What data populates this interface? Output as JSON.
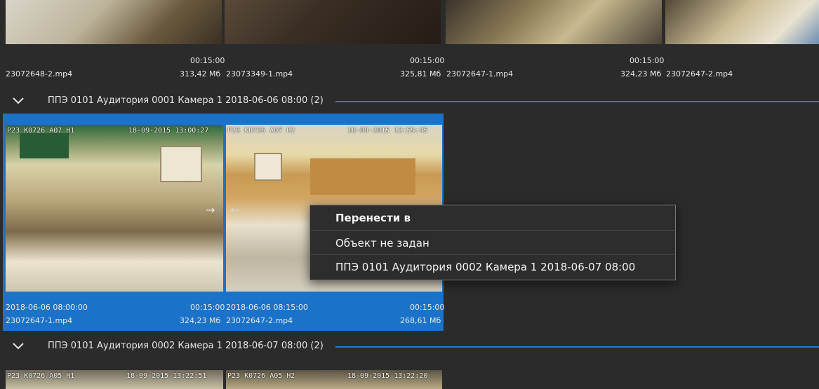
{
  "colors": {
    "background": "#2b2b2b",
    "selection": "#1a73c9",
    "accent_line": "#1f7bd1",
    "menu_bg": "#2d2d2d"
  },
  "top_row": {
    "items": [
      {
        "duration": "00:15:00",
        "filename": "23072648-2.mp4",
        "size": ""
      },
      {
        "duration": "00:15:00",
        "filename": "23073349-1.mp4",
        "size": "313,42 Мб"
      },
      {
        "duration": "00:15:00",
        "filename": "23072647-1.mp4",
        "size": "325,81 Мб"
      },
      {
        "duration": "",
        "filename": "23072647-2.mp4",
        "size": "324,23 Мб"
      }
    ]
  },
  "groups": [
    {
      "title": "ППЭ 0101 Аудитория 0001 Камера 1 2018-06-06 08:00 (2)",
      "chevron": "chevron-down-icon"
    },
    {
      "title": "ППЭ 0101 Аудитория 0002 Камера 1 2018-06-07 08:00 (2)",
      "chevron": "chevron-down-icon"
    }
  ],
  "selected_group": {
    "videos": [
      {
        "camera_stamp": "P23 K0726 A07 H1",
        "time_stamp": "18-09-2015 13:00:27",
        "start": "2018-06-06 08:00:00",
        "duration": "00:15:00",
        "filename": "23072647-1.mp4",
        "size": "324,23 Мб"
      },
      {
        "camera_stamp": "P23 K0726 A07 H2",
        "time_stamp": "18-09-2015 12:59:45",
        "start": "2018-06-06 08:15:00",
        "duration": "00:15:00",
        "filename": "23072647-2.mp4",
        "size": "268,61 Мб"
      }
    ]
  },
  "bottom_row": {
    "stamps": [
      {
        "camera_stamp": "P23 K0726 A05 H1",
        "time_stamp": "18-09-2015 13:22:51"
      },
      {
        "camera_stamp": "P23 K0726 A05 H2",
        "time_stamp": "18-09-2015 13:22:20"
      }
    ]
  },
  "context_menu": {
    "header": "Перенести в",
    "items": [
      "Объект не задан",
      "ППЭ 0101 Аудитория 0002 Камера 1 2018-06-07 08:00"
    ]
  }
}
